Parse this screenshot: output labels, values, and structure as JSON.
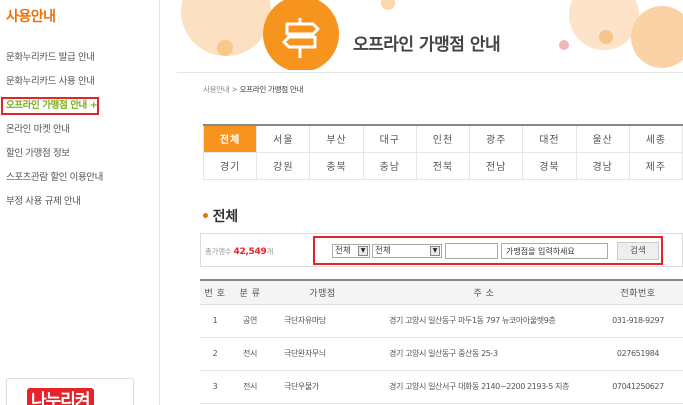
{
  "sidebar": {
    "title": "사용안내",
    "items": [
      {
        "label": "문화누리카드 발급 안내"
      },
      {
        "label": "문화누리카드 사용 안내"
      },
      {
        "label": "오프라인 가맹점 안내 +"
      },
      {
        "label": "온라인 마켓 안내"
      },
      {
        "label": "할인 가맹점 정보"
      },
      {
        "label": "스포츠관람 할인 이용안내"
      },
      {
        "label": "부정 사용 규제 안내"
      }
    ],
    "active_index": 2,
    "promo_label": "나누리켜"
  },
  "header": {
    "title": "오프라인 가맹점 안내",
    "icon": "signpost-icon",
    "accent_color": "#f7941d"
  },
  "breadcrumb": {
    "parent": "사용안내",
    "separator": " > ",
    "current": "오프라인 가맹점 안내"
  },
  "regions": {
    "row1": [
      "전체",
      "서울",
      "부산",
      "대구",
      "인천",
      "광주",
      "대전",
      "울산",
      "세종"
    ],
    "row2": [
      "경기",
      "강원",
      "충북",
      "충남",
      "전북",
      "전남",
      "경북",
      "경남",
      "제주"
    ],
    "selected": "전체"
  },
  "section": {
    "bullet": "•",
    "title": "전체"
  },
  "search": {
    "count_label": "총가맹수",
    "count_value": "42,549",
    "count_unit": "개",
    "select1_value": "전체",
    "select2_value": "전체",
    "text1_value": "",
    "keyword_placeholder": "가맹점을 입력하세요",
    "button_label": "검색"
  },
  "table": {
    "headers": [
      "번 호",
      "분 류",
      "가맹점",
      "주 소",
      "전화번호"
    ],
    "rows": [
      {
        "no": "1",
        "cat": "공연",
        "name": "극단자유마당",
        "addr": "경기 고양시 일산동구 마두1동 797 뉴코아아울렛9층",
        "tel": "031-918-9297"
      },
      {
        "no": "2",
        "cat": "전시",
        "name": "극단완자무늬",
        "addr": "경기 고양시 일산동구 중산동 25-3",
        "tel": "027651984"
      },
      {
        "no": "3",
        "cat": "전시",
        "name": "극단우물가",
        "addr": "경기 고양시 일산서구 대화동 2140~2200 2193-5 지층",
        "tel": "07041250627"
      }
    ]
  }
}
